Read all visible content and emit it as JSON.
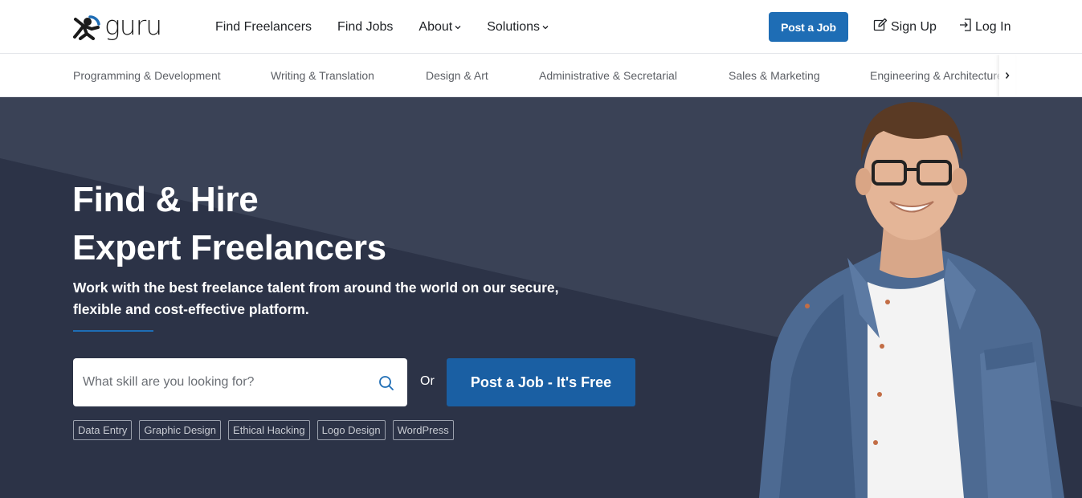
{
  "brand": {
    "name": "guru"
  },
  "nav": {
    "links": [
      {
        "label": "Find Freelancers",
        "has_dropdown": false
      },
      {
        "label": "Find Jobs",
        "has_dropdown": false
      },
      {
        "label": "About",
        "has_dropdown": true
      },
      {
        "label": "Solutions",
        "has_dropdown": true
      }
    ],
    "post_job_label": "Post a Job",
    "signup_label": "Sign Up",
    "login_label": "Log In"
  },
  "categories": [
    "Programming & Development",
    "Writing & Translation",
    "Design & Art",
    "Administrative & Secretarial",
    "Sales & Marketing",
    "Engineering & Architecture"
  ],
  "hero": {
    "title_line1": "Find & Hire",
    "title_line2": "Expert Freelancers",
    "subtitle": "Work with the best freelance talent from around the world on our secure, flexible and cost-effective platform.",
    "search_placeholder": "What skill are you looking for?",
    "or_label": "Or",
    "post_job_cta": "Post a Job - It's Free",
    "tags": [
      "Data Entry",
      "Graphic Design",
      "Ethical Hacking",
      "Logo Design",
      "WordPress"
    ]
  },
  "colors": {
    "accent": "#1e6db5",
    "hero_bg": "#3a4256",
    "hero_bg_dark": "#2a3144"
  },
  "icons": [
    "guru-logo-icon",
    "chevron-down-icon",
    "edit-icon",
    "login-icon",
    "chevron-right-icon",
    "search-icon"
  ]
}
